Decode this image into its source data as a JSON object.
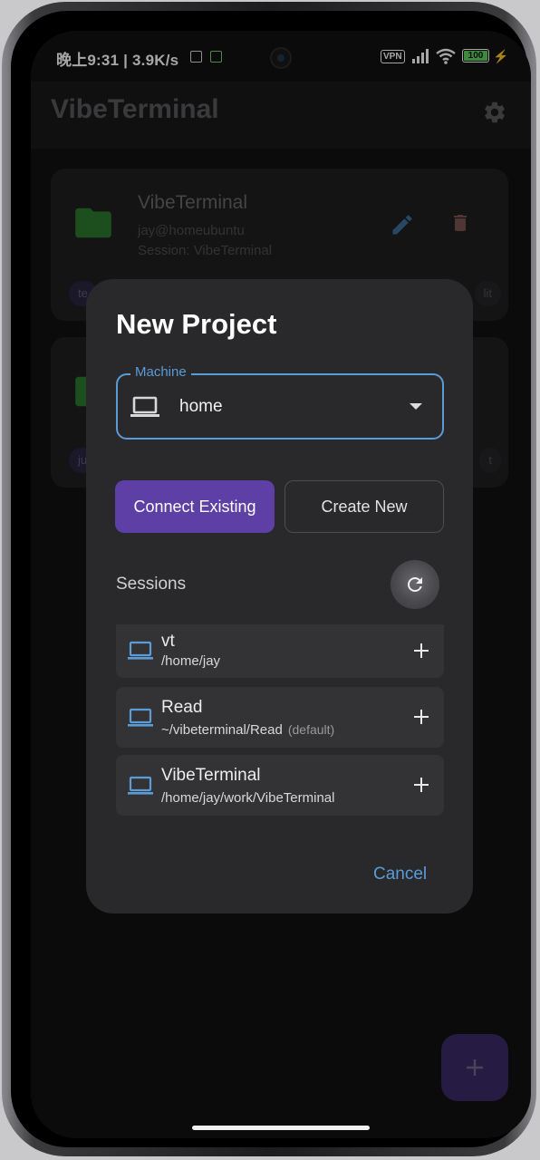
{
  "status_bar": {
    "time_speed": "晚上9:31 | 3.9K/s",
    "vpn": "VPN",
    "battery": "100"
  },
  "app_bar": {
    "title": "VibeTerminal"
  },
  "projects": [
    {
      "name": "VibeTerminal",
      "host": "jay@homeubuntu",
      "session": "Session: VibeTerminal",
      "chip_left": "te",
      "chip_right": "lit"
    },
    {
      "chip_left": "ju",
      "chip_right": "t"
    }
  ],
  "dialog": {
    "title": "New Project",
    "machine": {
      "label": "Machine",
      "value": "home"
    },
    "buttons": {
      "connect_existing": "Connect Existing",
      "create_new": "Create New",
      "cancel": "Cancel"
    },
    "sessions_label": "Sessions",
    "sessions": [
      {
        "name": "vt",
        "path": "/home/jay",
        "tag": ""
      },
      {
        "name": "Read",
        "path": "~/vibeterminal/Read",
        "tag": "(default)"
      },
      {
        "name": "VibeTerminal",
        "path": "/home/jay/work/VibeTerminal",
        "tag": ""
      }
    ]
  },
  "colors": {
    "accent_blue": "#5b9bd6",
    "primary_purple": "#5e3fa6",
    "dialog_bg": "#29292c",
    "folder_green": "#2d7a2f"
  },
  "icons": {
    "settings": "gear-icon",
    "folder": "folder-icon",
    "edit": "pencil-icon",
    "delete": "trash-icon",
    "machine": "laptop-icon",
    "refresh": "refresh-icon",
    "add": "plus-icon",
    "fab": "plus-icon"
  }
}
